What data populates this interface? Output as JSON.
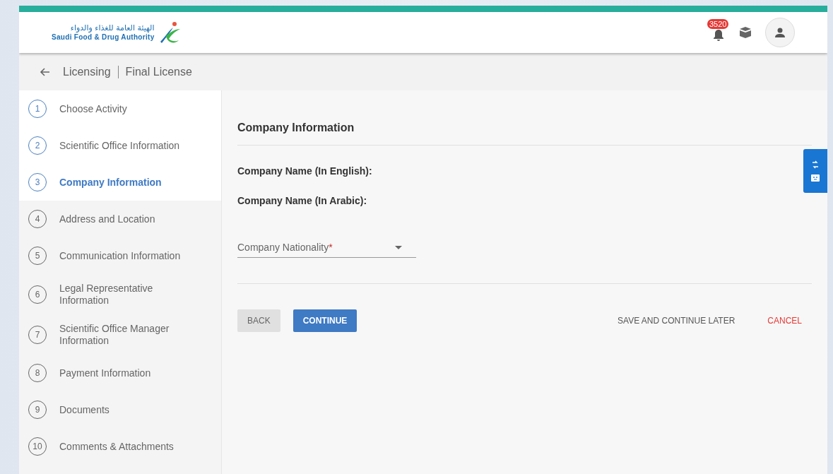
{
  "header": {
    "logo_arabic": "الهيئة العامة للغذاء والدواء",
    "logo_english": "Saudi Food & Drug Authority",
    "notification_count": "3520"
  },
  "breadcrumb": {
    "items": [
      "Licensing",
      "Final License"
    ]
  },
  "steps": [
    {
      "number": "1",
      "label": "Choose Activity",
      "completed": true,
      "selected": false
    },
    {
      "number": "2",
      "label": "Scientific Office Information",
      "completed": true,
      "selected": false
    },
    {
      "number": "3",
      "label": "Company Information",
      "completed": true,
      "selected": true
    },
    {
      "number": "4",
      "label": "Address and Location",
      "completed": false,
      "selected": false
    },
    {
      "number": "5",
      "label": "Communication Information",
      "completed": false,
      "selected": false
    },
    {
      "number": "6",
      "label": "Legal Representative Information",
      "completed": false,
      "selected": false
    },
    {
      "number": "7",
      "label": "Scientific Office Manager Information",
      "completed": false,
      "selected": false
    },
    {
      "number": "8",
      "label": "Payment Information",
      "completed": false,
      "selected": false
    },
    {
      "number": "9",
      "label": "Documents",
      "completed": false,
      "selected": false
    },
    {
      "number": "10",
      "label": "Comments & Attachments",
      "completed": false,
      "selected": false
    }
  ],
  "form": {
    "title": "Company Information",
    "fields": [
      {
        "label": "Company Name (In English):"
      },
      {
        "label": "Company Name (In Arabic):"
      }
    ],
    "dropdown": {
      "placeholder": "Company Nationality",
      "required_mark": "*"
    },
    "buttons": {
      "back": "BACK",
      "continue": "CONTINUE",
      "save_later": "SAVE AND CONTINUE LATER",
      "cancel": "CANCEL"
    }
  }
}
